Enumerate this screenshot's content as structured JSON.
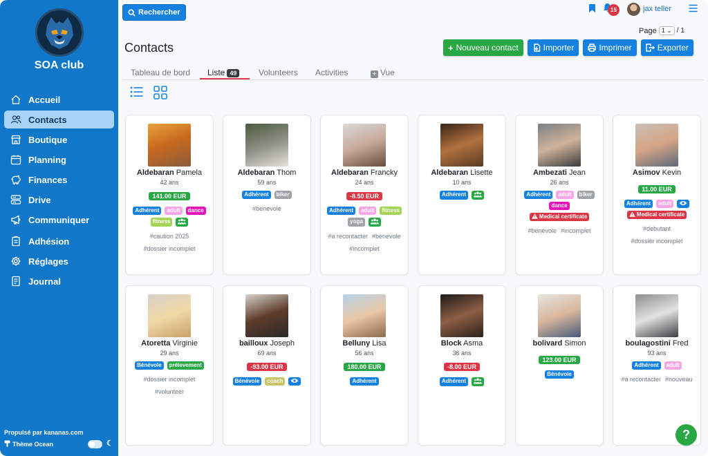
{
  "sidebar": {
    "club_name": "SOA club",
    "items": [
      {
        "label": "Accueil",
        "icon": "home-icon"
      },
      {
        "label": "Contacts",
        "icon": "users-icon",
        "active": true
      },
      {
        "label": "Boutique",
        "icon": "shop-icon"
      },
      {
        "label": "Planning",
        "icon": "calendar-icon"
      },
      {
        "label": "Finances",
        "icon": "piggy-bank-icon"
      },
      {
        "label": "Drive",
        "icon": "drive-icon"
      },
      {
        "label": "Communiquer",
        "icon": "megaphone-icon"
      },
      {
        "label": "Adhésion",
        "icon": "clipboard-icon"
      },
      {
        "label": "Réglages",
        "icon": "gear-icon"
      },
      {
        "label": "Journal",
        "icon": "journal-icon"
      }
    ],
    "powered_by": "Propulsé par kananas.com",
    "theme_label": "Thème Ocean"
  },
  "topbar": {
    "search_label": "Rechercher",
    "notification_count": "15",
    "user_name": "jax teller",
    "page_label": "Page",
    "page_current": "1",
    "page_total": "/ 1"
  },
  "header": {
    "title": "Contacts",
    "actions": [
      "Nouveau contact",
      "Importer",
      "Imprimer",
      "Exporter"
    ]
  },
  "tabs": {
    "dashboard": "Tableau de bord",
    "list": "Liste",
    "list_count": "49",
    "volunteers": "Volunteers",
    "activities": "Activities",
    "view": "Vue"
  },
  "colors": {
    "sidebar": "#1177c8",
    "primary": "#1480e0",
    "success": "#28a745",
    "danger": "#dc3545"
  },
  "contacts": [
    {
      "last": "Aldebaran",
      "first": "Pamela",
      "age": "42 ans",
      "amount": "141.00 EUR",
      "tags": [
        "Adhérent",
        "adult",
        "dance",
        "fitness",
        "group"
      ],
      "hashtags": [
        "#caution 2025",
        "#dossier incomplet"
      ]
    },
    {
      "last": "Aldebaran",
      "first": "Thom",
      "age": "59 ans",
      "amount": "",
      "tags": [
        "Adhérent",
        "biker"
      ],
      "hashtags": [
        "#benevole"
      ]
    },
    {
      "last": "Aldebaran",
      "first": "Francky",
      "age": "24 ans",
      "amount": "-8.50 EUR",
      "tags": [
        "Adhérent",
        "adult",
        "fitness",
        "yoga",
        "group"
      ],
      "hashtags": [
        "#a recontacter",
        "#benevole",
        "#incomplet"
      ]
    },
    {
      "last": "Aldebaran",
      "first": "Lisette",
      "age": "10 ans",
      "amount": "",
      "tags": [
        "Adhérent",
        "group"
      ],
      "hashtags": []
    },
    {
      "last": "Ambezati",
      "first": "Jean",
      "age": "26 ans",
      "amount": "",
      "tags": [
        "Adhérent",
        "adult",
        "biker",
        "dance",
        "Medical certificate"
      ],
      "hashtags": [
        "#benevole",
        "#incomplet"
      ]
    },
    {
      "last": "Asimov",
      "first": "Kevin",
      "age": "",
      "amount": "11.00 EUR",
      "tags": [
        "Adhérent",
        "adult",
        "eye",
        "Medical certificate"
      ],
      "hashtags": [
        "#debutant",
        "#dossier incomplet"
      ]
    },
    {
      "last": "Atoretta",
      "first": "Virginie",
      "age": "29 ans",
      "amount": "",
      "tags": [
        "Bénévole",
        "prélevement"
      ],
      "hashtags": [
        "#dossier incomplet",
        "#volunteer"
      ]
    },
    {
      "last": "bailloux",
      "first": "Joseph",
      "age": "69 ans",
      "amount": "-93.00 EUR",
      "tags": [
        "Bénévole",
        "coach",
        "eye"
      ],
      "hashtags": []
    },
    {
      "last": "Belluny",
      "first": "Lisa",
      "age": "56 ans",
      "amount": "180.00 EUR",
      "tags": [
        "Adhérent"
      ],
      "hashtags": []
    },
    {
      "last": "Block",
      "first": "Asma",
      "age": "36 ans",
      "amount": "-8.00 EUR",
      "tags": [
        "Adhérent",
        "group"
      ],
      "hashtags": []
    },
    {
      "last": "bolivard",
      "first": "Simon",
      "age": "",
      "amount": "123.00 EUR",
      "tags": [
        "Bénévole"
      ],
      "hashtags": []
    },
    {
      "last": "boulagostini",
      "first": "Fred",
      "age": "93 ans",
      "amount": "",
      "tags": [
        "Adhérent",
        "adult"
      ],
      "hashtags": [
        "#a recontacter",
        "#nouveau"
      ]
    }
  ]
}
